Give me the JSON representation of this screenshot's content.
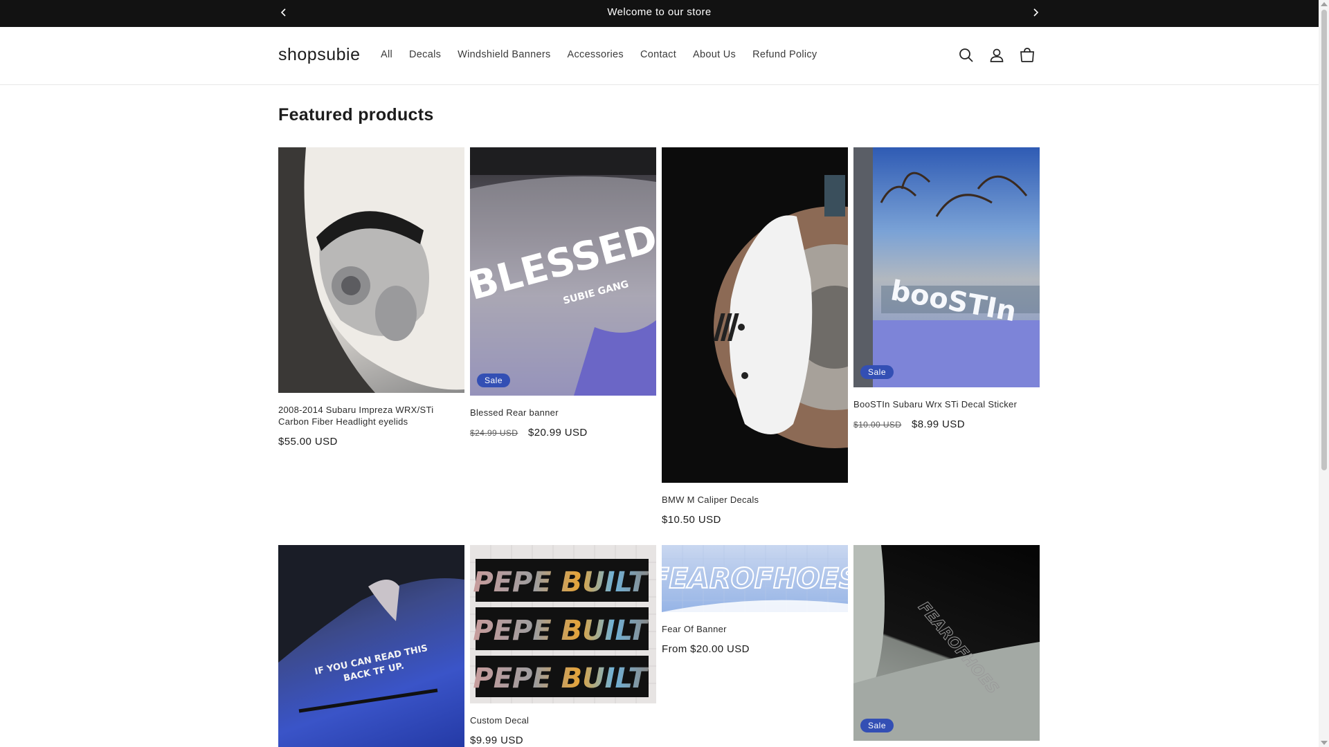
{
  "announcement": {
    "text": "Welcome to our store"
  },
  "header": {
    "logo": "shopsubie",
    "nav": [
      "All",
      "Decals",
      "Windshield Banners",
      "Accessories",
      "Contact",
      "About Us",
      "Refund Policy"
    ]
  },
  "section": {
    "title": "Featured products"
  },
  "products": [
    {
      "title": "2008-2014 Subaru Impreza WRX/STi Carbon Fiber Headlight eyelids",
      "price": "$55.00 USD",
      "old_price": "",
      "badge": ""
    },
    {
      "title": "Blessed Rear banner",
      "price": "$20.99 USD",
      "old_price": "$24.99 USD",
      "badge": "Sale",
      "img_text_1": "BLESSED",
      "img_text_2": "SUBIE GANG"
    },
    {
      "title": "BMW M Caliper Decals",
      "price": "$10.50 USD",
      "old_price": "",
      "badge": ""
    },
    {
      "title": "BooSTIn Subaru Wrx STi Decal Sticker",
      "price": "$8.99 USD",
      "old_price": "$10.00 USD",
      "badge": "Sale",
      "img_text": "booSTIn"
    },
    {
      "title": "",
      "price": "",
      "old_price": "",
      "badge": "",
      "img_text_1": "IF YOU CAN READ THIS",
      "img_text_2": "BACK TF UP."
    },
    {
      "title": "Custom Decal",
      "price": "$9.99 USD",
      "old_price": "",
      "badge": "",
      "img_text": "PEPE BUILT"
    },
    {
      "title": "Fear Of Banner",
      "price": "From $20.00 USD",
      "old_price": "",
      "badge": "",
      "img_text": "FEAROFHOES"
    },
    {
      "title": "",
      "price": "",
      "old_price": "",
      "badge": "Sale",
      "img_text": "FEAROFHOES"
    }
  ],
  "colors": {
    "announce_bg": "#121212",
    "badge": "#334fb4",
    "text": "#121212"
  },
  "icons": [
    "chevron-left-icon",
    "chevron-right-icon",
    "search-icon",
    "account-icon",
    "cart-icon"
  ]
}
